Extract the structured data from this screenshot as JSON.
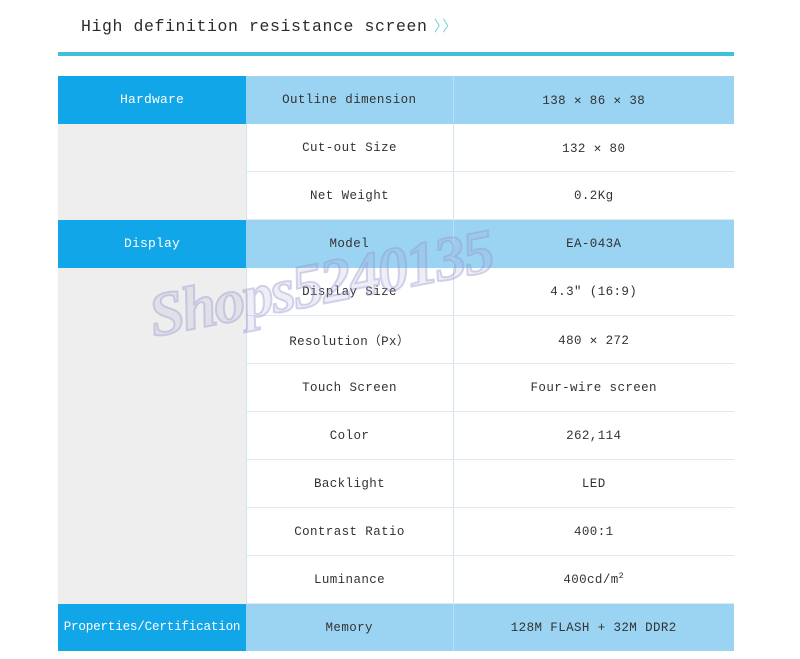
{
  "header": {
    "title": "High definition resistance screen",
    "chevrons": "〉〉",
    "accent_color": "#3ec1d6"
  },
  "watermark": {
    "text": "Shops5240135"
  },
  "colors": {
    "header_blue": "#10a6e8",
    "accent_row_blue": "#9ad4f2",
    "group_gray": "#eeeeee",
    "rule_teal": "#3ec1d6",
    "grid_line": "#ddeaf1"
  },
  "table": {
    "rows": [
      {
        "group": "Hardware",
        "group_style": "header",
        "item": "Outline dimension",
        "value": "138 ✕ 86 ✕ 38",
        "accent": true
      },
      {
        "group": "",
        "group_style": "spacer",
        "item": "Cut-out Size",
        "value": "132 ✕ 80",
        "accent": false
      },
      {
        "group": "",
        "group_style": "spacer",
        "item": "Net Weight",
        "value": "0.2Kg",
        "accent": false
      },
      {
        "group": "Display",
        "group_style": "header",
        "item": "Model",
        "value": "EA-043A",
        "accent": true
      },
      {
        "group": "",
        "group_style": "spacer",
        "item": "Display Size",
        "value": "4.3″ (16:9)",
        "accent": false
      },
      {
        "group": "",
        "group_style": "spacer",
        "item": "Resolution（Px）",
        "value": "480 ✕ 272",
        "accent": false
      },
      {
        "group": "",
        "group_style": "spacer",
        "item": "Touch Screen",
        "value": "Four-wire screen",
        "accent": false
      },
      {
        "group": "",
        "group_style": "spacer",
        "item": "Color",
        "value": "262,114",
        "accent": false
      },
      {
        "group": "",
        "group_style": "spacer",
        "item": "Backlight",
        "value": "LED",
        "accent": false
      },
      {
        "group": "",
        "group_style": "spacer",
        "item": "Contrast Ratio",
        "value": "400:1",
        "accent": false
      },
      {
        "group": "",
        "group_style": "spacer",
        "item": "Luminance",
        "value": "400cd/m2",
        "value_html": "400cd/m<sup>2</sup>",
        "accent": false
      },
      {
        "group": "Properties/Certification",
        "group_style": "header-tight",
        "item": "Memory",
        "value": "128M FLASH + 32M DDR2",
        "accent": true
      }
    ]
  }
}
